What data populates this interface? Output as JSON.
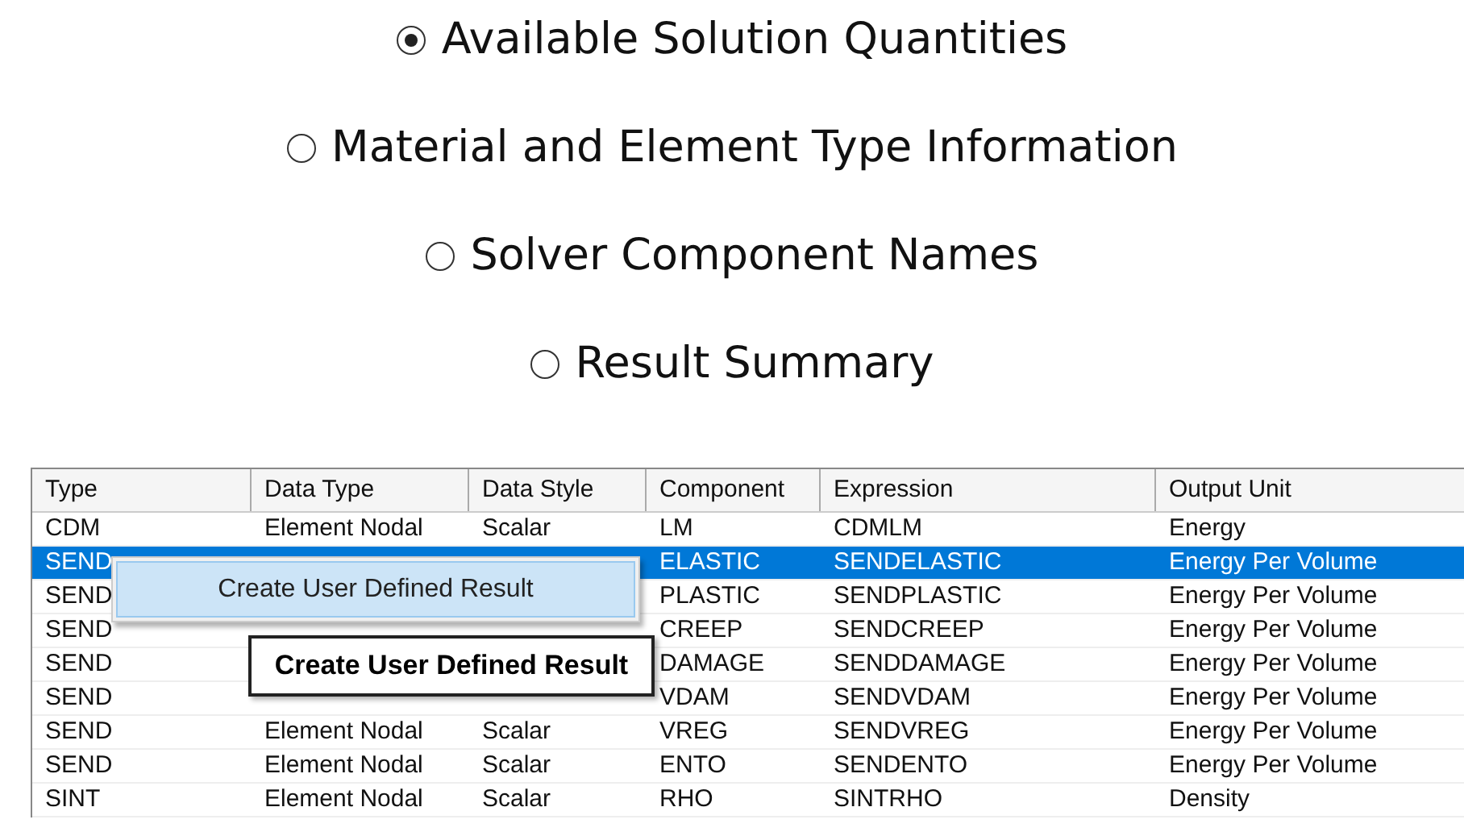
{
  "options": [
    {
      "label": "Available Solution Quantities",
      "selected": true
    },
    {
      "label": "Material and Element Type Information",
      "selected": false
    },
    {
      "label": "Solver Component Names",
      "selected": false
    },
    {
      "label": "Result Summary",
      "selected": false
    }
  ],
  "table": {
    "columns": [
      "Type",
      "Data Type",
      "Data Style",
      "Component",
      "Expression",
      "Output Unit"
    ],
    "rows": [
      {
        "cells": [
          "CDM",
          "Element Nodal",
          "Scalar",
          "LM",
          "CDMLM",
          "Energy"
        ],
        "selected": false
      },
      {
        "cells": [
          "SEND",
          null,
          null,
          "ELASTIC",
          "SENDELASTIC",
          "Energy Per Volume"
        ],
        "selected": true
      },
      {
        "cells": [
          "SEND",
          null,
          null,
          "PLASTIC",
          "SENDPLASTIC",
          "Energy Per Volume"
        ],
        "selected": false
      },
      {
        "cells": [
          "SEND",
          null,
          null,
          "CREEP",
          "SENDCREEP",
          "Energy Per Volume"
        ],
        "selected": false
      },
      {
        "cells": [
          "SEND",
          null,
          null,
          "DAMAGE",
          "SENDDAMAGE",
          "Energy Per Volume"
        ],
        "selected": false
      },
      {
        "cells": [
          "SEND",
          null,
          null,
          "VDAM",
          "SENDVDAM",
          "Energy Per Volume"
        ],
        "selected": false
      },
      {
        "cells": [
          "SEND",
          "Element Nodal",
          "Scalar",
          "VREG",
          "SENDVREG",
          "Energy Per Volume"
        ],
        "selected": false
      },
      {
        "cells": [
          "SEND",
          "Element Nodal",
          "Scalar",
          "ENTO",
          "SENDENTO",
          "Energy Per Volume"
        ],
        "selected": false
      },
      {
        "cells": [
          "SINT",
          "Element Nodal",
          "Scalar",
          "RHO",
          "SINTRHO",
          "Density"
        ],
        "selected": false
      }
    ]
  },
  "context_menu": {
    "items": [
      "Create User Defined Result"
    ]
  },
  "tooltip": {
    "text": "Create User Defined Result"
  }
}
